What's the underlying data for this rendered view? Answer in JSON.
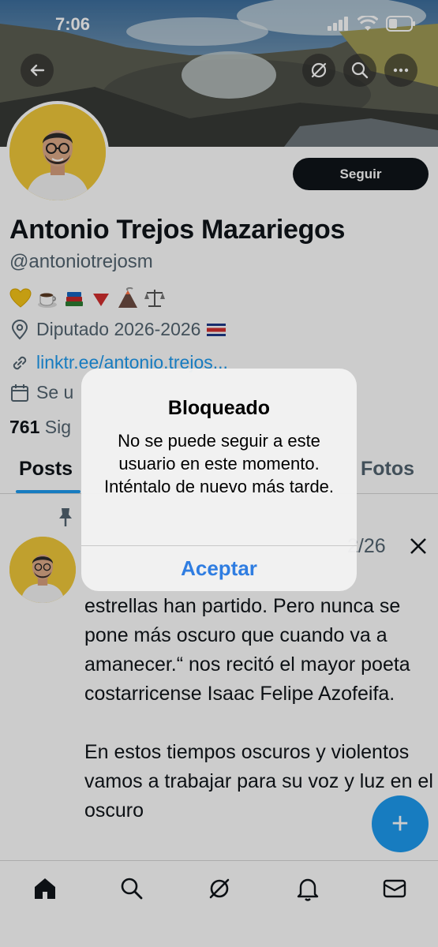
{
  "status": {
    "time": "7:06"
  },
  "profile": {
    "follow_label": "Seguir",
    "name": "Antonio Trejos Mazariegos",
    "handle": "@antoniotrejosm",
    "location": "Diputado 2026-2026",
    "link": "linktr.ee/antonio.trejos...",
    "joined": "Se u",
    "following_count": "761",
    "following_label": "Sig"
  },
  "tabs": [
    "Posts",
    "Fotos"
  ],
  "post": {
    "date_fragment": "2/26",
    "paragraphs": [
      "estrellas han partido. Pero nunca se pone más oscuro que cuando va a amanecer.“ nos recitó el mayor poeta costarricense Isaac Felipe Azofeifa.",
      "En estos tiempos oscuros y violentos vamos a trabajar para su voz y luz en el oscuro"
    ]
  },
  "fab_label": "+",
  "alert": {
    "title": "Bloqueado",
    "message": "No se puede seguir a este usuario en este momento. Inténtalo de nuevo más tarde.",
    "button": "Aceptar"
  },
  "colors": {
    "accent": "#1d9bf0",
    "alert_button": "#2f7de1",
    "avatar_bg": "#f0c93a"
  },
  "icons": [
    "back-arrow-icon",
    "grok-icon",
    "search-icon",
    "more-icon",
    "location-icon",
    "link-icon",
    "calendar-icon",
    "pin-icon",
    "x-logo-icon",
    "home-icon",
    "search-icon",
    "grok-icon",
    "bell-icon",
    "mail-icon"
  ]
}
